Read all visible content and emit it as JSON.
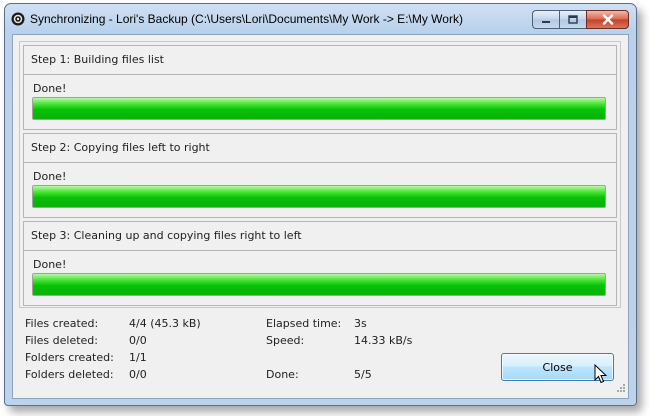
{
  "window": {
    "title": "Synchronizing - Lori's Backup (C:\\Users\\Lori\\Documents\\My Work -> E:\\My Work)",
    "icons": {
      "app": "sync-app-icon",
      "minimize": "minimize-icon",
      "maximize": "maximize-icon",
      "close": "close-icon"
    }
  },
  "steps": [
    {
      "title": "Step 1: Building files list",
      "status": "Done!",
      "progress": 1.0
    },
    {
      "title": "Step 2: Copying files left to right",
      "status": "Done!",
      "progress": 1.0
    },
    {
      "title": "Step 3: Cleaning up and copying files right to left",
      "status": "Done!",
      "progress": 1.0
    }
  ],
  "stats": {
    "files_created_label": "Files created:",
    "files_created_value": "4/4 (45.3 kB)",
    "files_deleted_label": "Files deleted:",
    "files_deleted_value": "0/0",
    "folders_created_label": "Folders created:",
    "folders_created_value": "1/1",
    "folders_deleted_label": "Folders deleted:",
    "folders_deleted_value": "0/0",
    "elapsed_label": "Elapsed time:",
    "elapsed_value": "3s",
    "speed_label": "Speed:",
    "speed_value": "14.33 kB/s",
    "done_label": "Done:",
    "done_value": "5/5"
  },
  "buttons": {
    "close_label": "Close"
  },
  "colors": {
    "progress_green": "#07c207",
    "title_bar": "#bcd3ed",
    "close_red": "#c4402a"
  }
}
